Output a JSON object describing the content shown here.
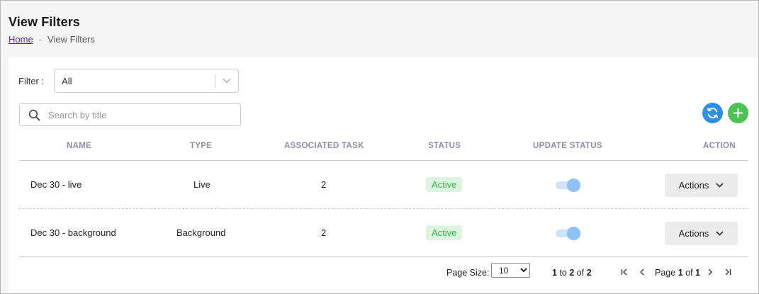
{
  "header": {
    "title": "View Filters",
    "breadcrumb": {
      "home": "Home",
      "separator": "-",
      "current": "View Filters"
    }
  },
  "filter": {
    "label": "Filter :",
    "selected": "All"
  },
  "search": {
    "placeholder": "Search by title",
    "value": ""
  },
  "icons": {
    "search": "search-icon",
    "refresh": "refresh-icon",
    "add": "plus-icon",
    "chevron": "chevron-down-icon",
    "first": "first-page-icon",
    "prev": "previous-page-icon",
    "next": "next-page-icon",
    "last": "last-page-icon"
  },
  "colors": {
    "refresh": "#2f8fe8",
    "add": "#4bc251",
    "active_bg": "#dcf5e1",
    "active_text": "#3bb54a"
  },
  "table": {
    "headers": [
      "NAME",
      "TYPE",
      "ASSOCIATED TASK",
      "STATUS",
      "UPDATE STATUS",
      "ACTION"
    ],
    "rows": [
      {
        "name": "Dec 30 - live",
        "type": "Live",
        "associated_task": "2",
        "status": "Active",
        "update_status_on": true,
        "action_label": "Actions"
      },
      {
        "name": "Dec 30 - background",
        "type": "Background",
        "associated_task": "2",
        "status": "Active",
        "update_status_on": true,
        "action_label": "Actions"
      }
    ]
  },
  "pagination": {
    "page_size_label": "Page Size:",
    "page_size": "10",
    "range_from": "1",
    "range_to_word": "to",
    "range_to": "2",
    "of_word": "of",
    "total": "2",
    "page_word": "Page",
    "page_current": "1",
    "page_of_word": "of",
    "page_total": "1"
  }
}
